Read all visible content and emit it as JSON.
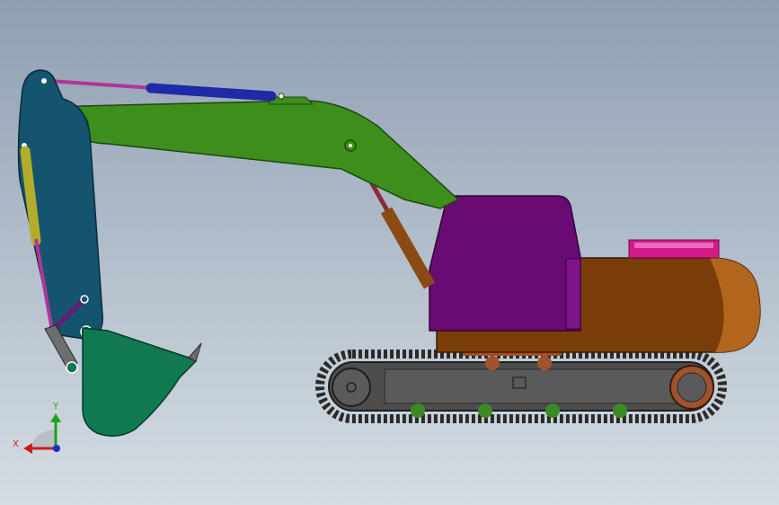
{
  "viewport": {
    "background_top": "#8f9fb3",
    "background_bottom": "#d5dde3"
  },
  "colors": {
    "boom": "#3e8e1e",
    "stick": "#14546f",
    "bucket": "#0f7a52",
    "cab": "#6a0a73",
    "house": "#7a3d0a",
    "counterweight_top": "#d21a8a",
    "track_frame": "#555555",
    "track_chain": "#2b2b2b",
    "bucket_cylinder": "#b3ad2a",
    "stick_cylinder": "#1f2aa6",
    "boom_cylinder": "#8b4a13",
    "rods": "#b0359a",
    "rollers": "#3c8a26",
    "sprocket": "#a0522d"
  },
  "triad": {
    "x_label": "X",
    "y_label": "Y",
    "x_color": "#d11a1a",
    "y_color": "#1aa51a",
    "z_color": "#1a2ad1"
  }
}
